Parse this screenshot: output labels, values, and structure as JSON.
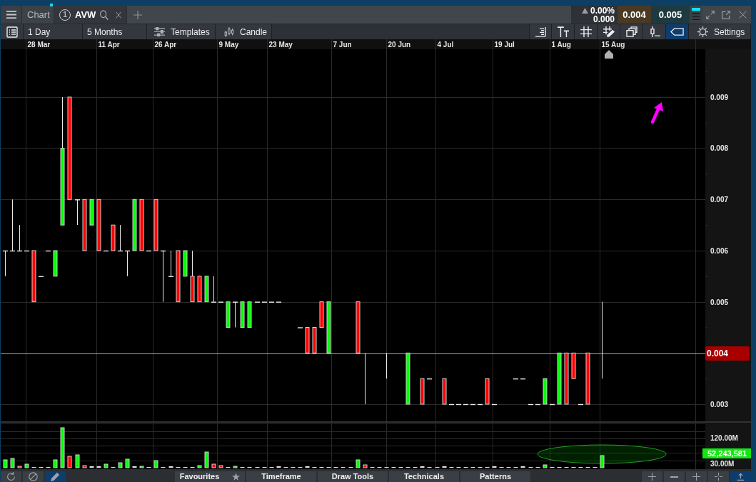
{
  "tabs": [
    {
      "kind": "title",
      "label": "Chart",
      "selected": false
    },
    {
      "kind": "symbol",
      "link_number": "1",
      "label": "AVW",
      "selected": true
    }
  ],
  "quote": {
    "change_percent": "0.00%",
    "change": "0.000",
    "bid": "0.004",
    "ask": "0.005"
  },
  "toolbar": {
    "left_tools": [
      {
        "kind": "list",
        "selected": false
      }
    ],
    "interval": "1 Day",
    "range": "5 Months",
    "templates": "Templates",
    "chart_type": "Candle",
    "right_tools": [
      {
        "kind": "align",
        "selected": false
      },
      {
        "kind": "text-size",
        "selected": false
      },
      {
        "kind": "grid",
        "selected": false
      },
      {
        "kind": "grid-draw",
        "selected": false
      },
      {
        "kind": "layers",
        "selected": false
      },
      {
        "kind": "candle-line",
        "selected": false
      },
      {
        "kind": "tag",
        "selected": true
      }
    ],
    "settings": "Settings"
  },
  "chart": {
    "dates": [
      "28 Mar",
      "11 Apr",
      "26 Apr",
      "9 May",
      "23 May",
      "7 Jun",
      "20 Jun",
      "4 Jul",
      "19 Jul",
      "1 Aug",
      "15 Aug"
    ],
    "price_ticks": [
      "0.009",
      "0.008",
      "0.007",
      "0.006",
      "0.005",
      "0.003"
    ],
    "last_price": "0.004",
    "volume_ticks": [
      "120.00M",
      "30.00M"
    ],
    "last_volume": "52,243,581"
  },
  "bottom_bar": {
    "left_tools": [
      {
        "kind": "refresh",
        "selected": false
      },
      {
        "kind": "clear",
        "selected": false
      },
      {
        "kind": "pencil",
        "selected": true
      }
    ],
    "menus": [
      {
        "kind": "starred",
        "label": "Favourites"
      },
      {
        "kind": "plain",
        "label": "Timeframe"
      },
      {
        "kind": "plain",
        "label": "Draw Tools"
      },
      {
        "kind": "plain",
        "label": "Technicals"
      },
      {
        "kind": "plain",
        "label": "Patterns"
      }
    ],
    "right_tools": [
      {
        "kind": "plus",
        "selected": false
      },
      {
        "kind": "minus",
        "selected": false
      },
      {
        "kind": "plus",
        "selected": false
      },
      {
        "kind": "crosshair",
        "selected": false
      },
      {
        "kind": "upload",
        "selected": true
      }
    ]
  }
}
